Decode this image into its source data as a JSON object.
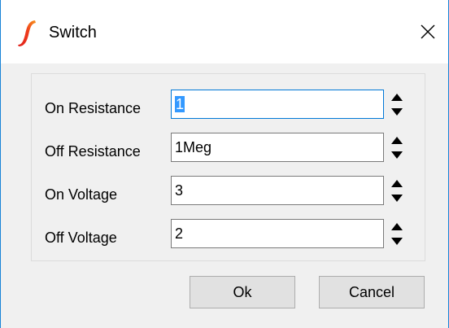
{
  "window": {
    "title": "Switch",
    "app_icon": "simetrix-logo-icon",
    "close_icon": "close-icon",
    "accent_color": "#1883d7"
  },
  "fields": [
    {
      "label": "On Resistance",
      "value_selected": "1",
      "value": ""
    },
    {
      "label": "Off Resistance",
      "value": "1Meg"
    },
    {
      "label": "On Voltage",
      "value": "3"
    },
    {
      "label": "Off Voltage",
      "value": "2"
    }
  ],
  "spinner_icons": {
    "up": "spin-up-arrow-icon",
    "down": "spin-down-arrow-icon"
  },
  "buttons": {
    "ok_label": "Ok",
    "cancel_label": "Cancel"
  },
  "colors": {
    "selection": "#3399ff",
    "focus_border": "#0078d7",
    "logo_red": "#e0201b",
    "logo_orange": "#f7941d"
  }
}
